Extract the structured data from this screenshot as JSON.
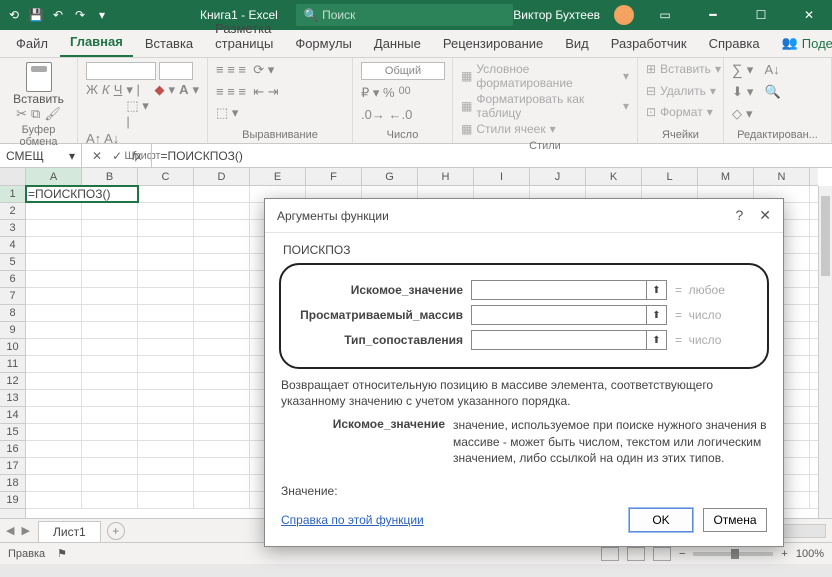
{
  "titlebar": {
    "doc_title": "Книга1 - Excel",
    "search_placeholder": "Поиск",
    "user_name": "Виктор Бухтеев"
  },
  "tabs": {
    "file": "Файл",
    "home": "Главная",
    "insert": "Вставка",
    "layout": "Разметка страницы",
    "formulas": "Формулы",
    "data": "Данные",
    "review": "Рецензирование",
    "view": "Вид",
    "developer": "Разработчик",
    "help": "Справка",
    "share": "Поделиться"
  },
  "ribbon": {
    "paste": "Вставить",
    "clipboard": "Буфер обмена",
    "font": "Шрифт",
    "align": "Выравнивание",
    "number": "Число",
    "styles": "Стили",
    "cells": "Ячейки",
    "editing": "Редактирован...",
    "number_format": "Общий",
    "cond_fmt": "Условное форматирование",
    "as_table": "Форматировать как таблицу",
    "cell_styles": "Стили ячеек",
    "insert_cell": "Вставить",
    "delete_cell": "Удалить",
    "format_cell": "Формат"
  },
  "formula_bar": {
    "name_box": "СМЕЩ",
    "formula": "=ПОИСКПОЗ()"
  },
  "grid": {
    "columns": [
      "A",
      "B",
      "C",
      "D",
      "E",
      "F",
      "G",
      "H",
      "I",
      "J",
      "K",
      "L",
      "M",
      "N"
    ],
    "rows": [
      "1",
      "2",
      "3",
      "4",
      "5",
      "6",
      "7",
      "8",
      "9",
      "10",
      "11",
      "12",
      "13",
      "14",
      "15",
      "16",
      "17",
      "18",
      "19"
    ],
    "active_cell_value": "=ПОИСКПОЗ()"
  },
  "sheet": {
    "name": "Лист1"
  },
  "status": {
    "mode": "Правка",
    "zoom": "100%"
  },
  "dialog": {
    "title": "Аргументы функции",
    "fn": "ПОИСКПОЗ",
    "args": [
      {
        "label": "Искомое_значение",
        "hint": "любое"
      },
      {
        "label": "Просматриваемый_массив",
        "hint": "число"
      },
      {
        "label": "Тип_сопоставления",
        "hint": "число"
      }
    ],
    "description": "Возвращает относительную позицию в массиве элемента, соответствующего указанному значению с учетом указанного порядка.",
    "arg_name": "Искомое_значение",
    "arg_desc": "значение, используемое при поиске нужного значения в массиве - может быть числом, текстом или логическим значением, либо ссылкой на один из этих типов.",
    "value_label": "Значение:",
    "help": "Справка по этой функции",
    "ok": "OK",
    "cancel": "Отмена"
  }
}
